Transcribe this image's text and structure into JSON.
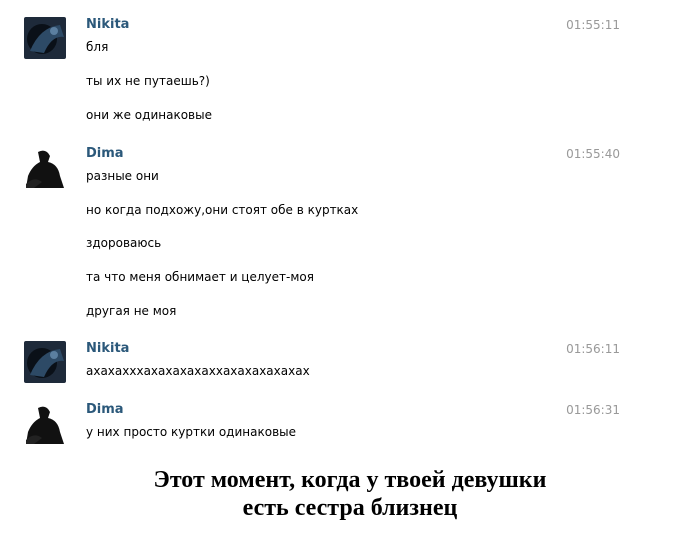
{
  "conversation": [
    {
      "sender": "Nikita",
      "time": "01:55:11",
      "avatar": "nikita-avatar",
      "messages": [
        "бля",
        "ты их не путаешь?)",
        "они же одинаковые"
      ]
    },
    {
      "sender": "Dima",
      "time": "01:55:40",
      "avatar": "dima-avatar",
      "messages": [
        "разные они",
        "но когда подхожу,они стоят обе в куртках",
        "здороваюсь",
        "та что меня обнимает и целует-моя",
        "другая не моя"
      ]
    },
    {
      "sender": "Nikita",
      "time": "01:56:11",
      "avatar": "nikita-avatar",
      "messages": [
        "ахахахххахахахахаххахахахахахах"
      ]
    },
    {
      "sender": "Dima",
      "time": "01:56:31",
      "avatar": "dima-avatar",
      "messages": [
        "у них просто куртки одинаковые"
      ]
    }
  ],
  "caption": {
    "line1": "Этот момент, когда у твоей девушки",
    "line2": "есть сестра близнец"
  },
  "colors": {
    "sender_name": "#2b587a",
    "timestamp": "#999999",
    "message_text": "#000000"
  }
}
